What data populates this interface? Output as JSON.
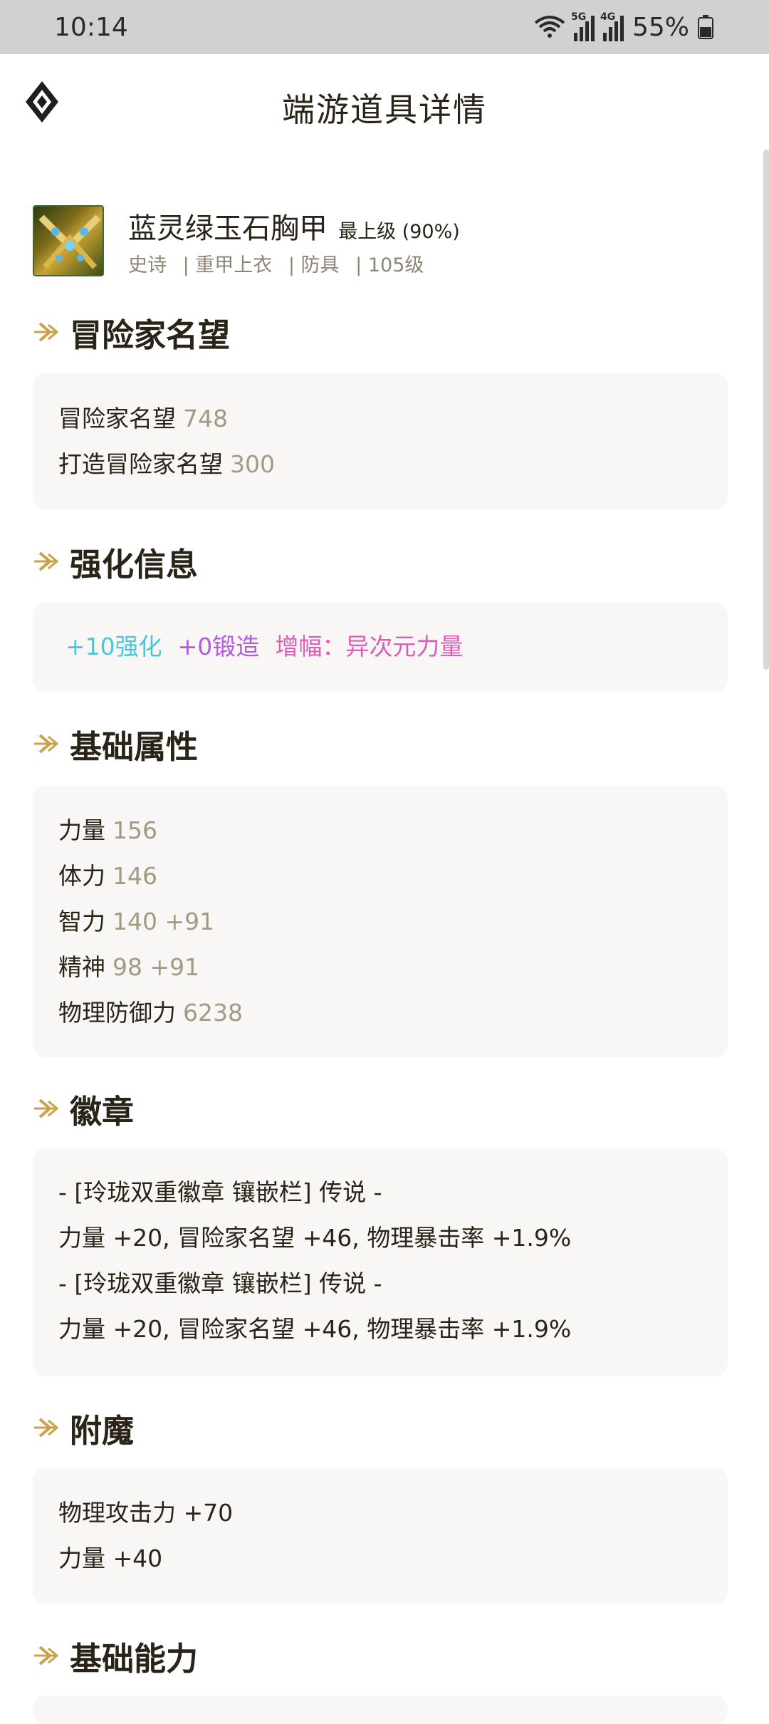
{
  "status_bar": {
    "time": "10:14",
    "battery": "55%",
    "network_tags": [
      "5G",
      "4G"
    ]
  },
  "header": {
    "title": "端游道具详情"
  },
  "item": {
    "name": "蓝灵绿玉石胸甲",
    "grade": "最上级 (90%)",
    "meta": [
      "史诗",
      "| 重甲上衣",
      "| 防具",
      "| 105级"
    ]
  },
  "sections": {
    "reputation": {
      "title": "冒险家名望",
      "rows": [
        {
          "label": "冒险家名望",
          "value": "748"
        },
        {
          "label": "打造冒险家名望",
          "value": "300"
        }
      ]
    },
    "enhance": {
      "title": "强化信息",
      "reinforce": "+10强化",
      "forge": "+0锻造",
      "amplify": "增幅：异次元力量",
      "colors": {
        "reinforce": "#49c6dc",
        "forge": "#b35ae0",
        "amplify": "#e05ab8"
      }
    },
    "base": {
      "title": "基础属性",
      "rows": [
        {
          "label": "力量",
          "value": "156"
        },
        {
          "label": "体力",
          "value": "146"
        },
        {
          "label": "智力",
          "value": "140 +91"
        },
        {
          "label": "精神",
          "value": "98 +91"
        },
        {
          "label": "物理防御力",
          "value": "6238"
        }
      ]
    },
    "emblem": {
      "title": "徽章",
      "lines": [
        "- [玲珑双重徽章 镶嵌栏] 传说 -",
        "力量 +20, 冒险家名望 +46, 物理暴击率 +1.9%",
        "- [玲珑双重徽章 镶嵌栏] 传说 -",
        "力量 +20, 冒险家名望 +46, 物理暴击率 +1.9%"
      ]
    },
    "enchant": {
      "title": "附魔",
      "lines": [
        "物理攻击力 +70",
        "力量 +40"
      ]
    },
    "ability": {
      "title": "基础能力"
    }
  },
  "accent_color": "#c9a24a"
}
